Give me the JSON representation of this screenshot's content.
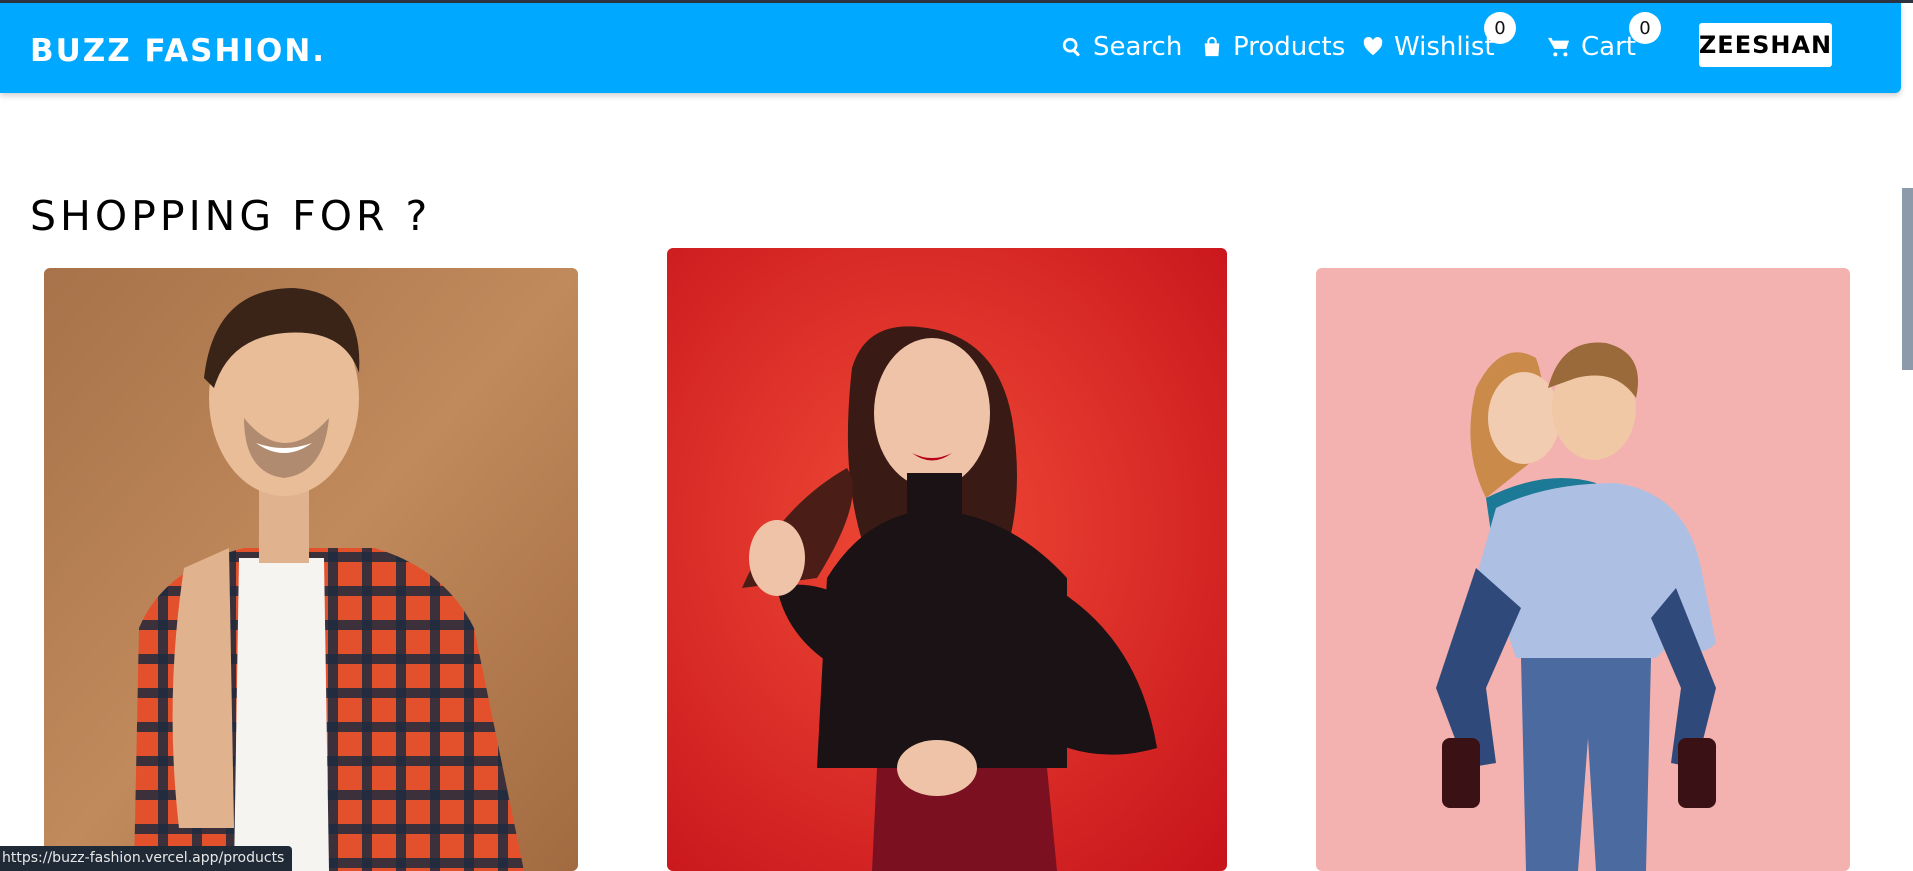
{
  "brand": "BUZZ FASHION.",
  "nav": {
    "search_label": "Search",
    "products_label": "Products",
    "wishlist_label": "Wishlist",
    "wishlist_count": "0",
    "cart_label": "Cart",
    "cart_count": "0",
    "user_label": "ZEESHAN"
  },
  "section": {
    "title": "SHOPPING FOR ?"
  },
  "categories": [
    {
      "image": "man-in-plaid-shirt",
      "bg": "#b47a4c"
    },
    {
      "image": "woman-in-black-top",
      "bg": "#e8342a"
    },
    {
      "image": "kids-piggyback",
      "bg": "#f3b2b0"
    }
  ],
  "colors": {
    "navbar": "#00a8ff",
    "text": "#000000"
  },
  "status_url": "https://buzz-fashion.vercel.app/products"
}
